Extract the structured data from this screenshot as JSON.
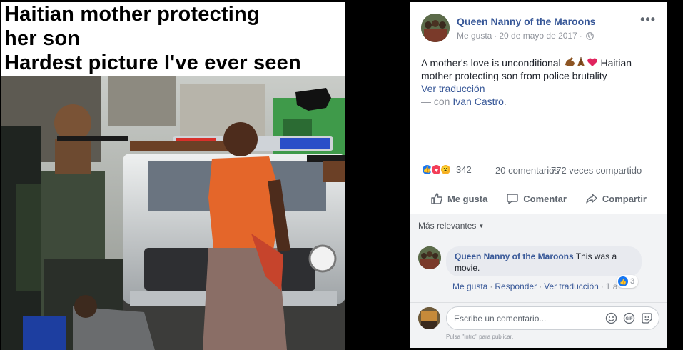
{
  "meme": {
    "caption_lines": [
      "Haitian mother protecting",
      "her son",
      "Hardest picture I've ever seen"
    ],
    "watermark": "BM"
  },
  "post": {
    "page_name": "Queen Nanny of the Maroons",
    "like_link": "Me gusta",
    "separator": "·",
    "date": "20 de mayo de 2017",
    "more_icon": "more-horizontal-icon",
    "text_before_emoji": "A mother's love is unconditional ",
    "emojis": [
      "flexed-biceps-emoji",
      "praying-hands-emoji",
      "red-heart-emoji"
    ],
    "text_after_emoji": " Haitian mother protecting son from police brutality",
    "translate": "Ver traducción",
    "with_prefix": "— con ",
    "with_person": "Ivan Castro",
    "with_suffix": ".",
    "reaction_icons": [
      "like-reaction-icon",
      "love-reaction-icon",
      "wow-reaction-icon"
    ],
    "reaction_count": "342",
    "comments_count": "20 comentarios",
    "shares_count": "772 veces compartido",
    "actions": {
      "like": "Me gusta",
      "comment": "Comentar",
      "share": "Compartir"
    }
  },
  "comments": {
    "sort_label": "Más relevantes",
    "items": [
      {
        "author": "Queen Nanny of the Maroons",
        "text": " This was a movie.",
        "reaction_count": "3",
        "like": "Me gusta",
        "reply": "Responder",
        "translate": "Ver traducción",
        "time": "1 a"
      }
    ],
    "input_placeholder": "Escribe un comentario...",
    "hint": "Pulsa \"Intro\" para publicar."
  },
  "colors": {
    "link_blue": "#385898",
    "like_blue": "#1877f2",
    "love_red": "#f33e58",
    "wow_yellow": "#f7b125"
  }
}
